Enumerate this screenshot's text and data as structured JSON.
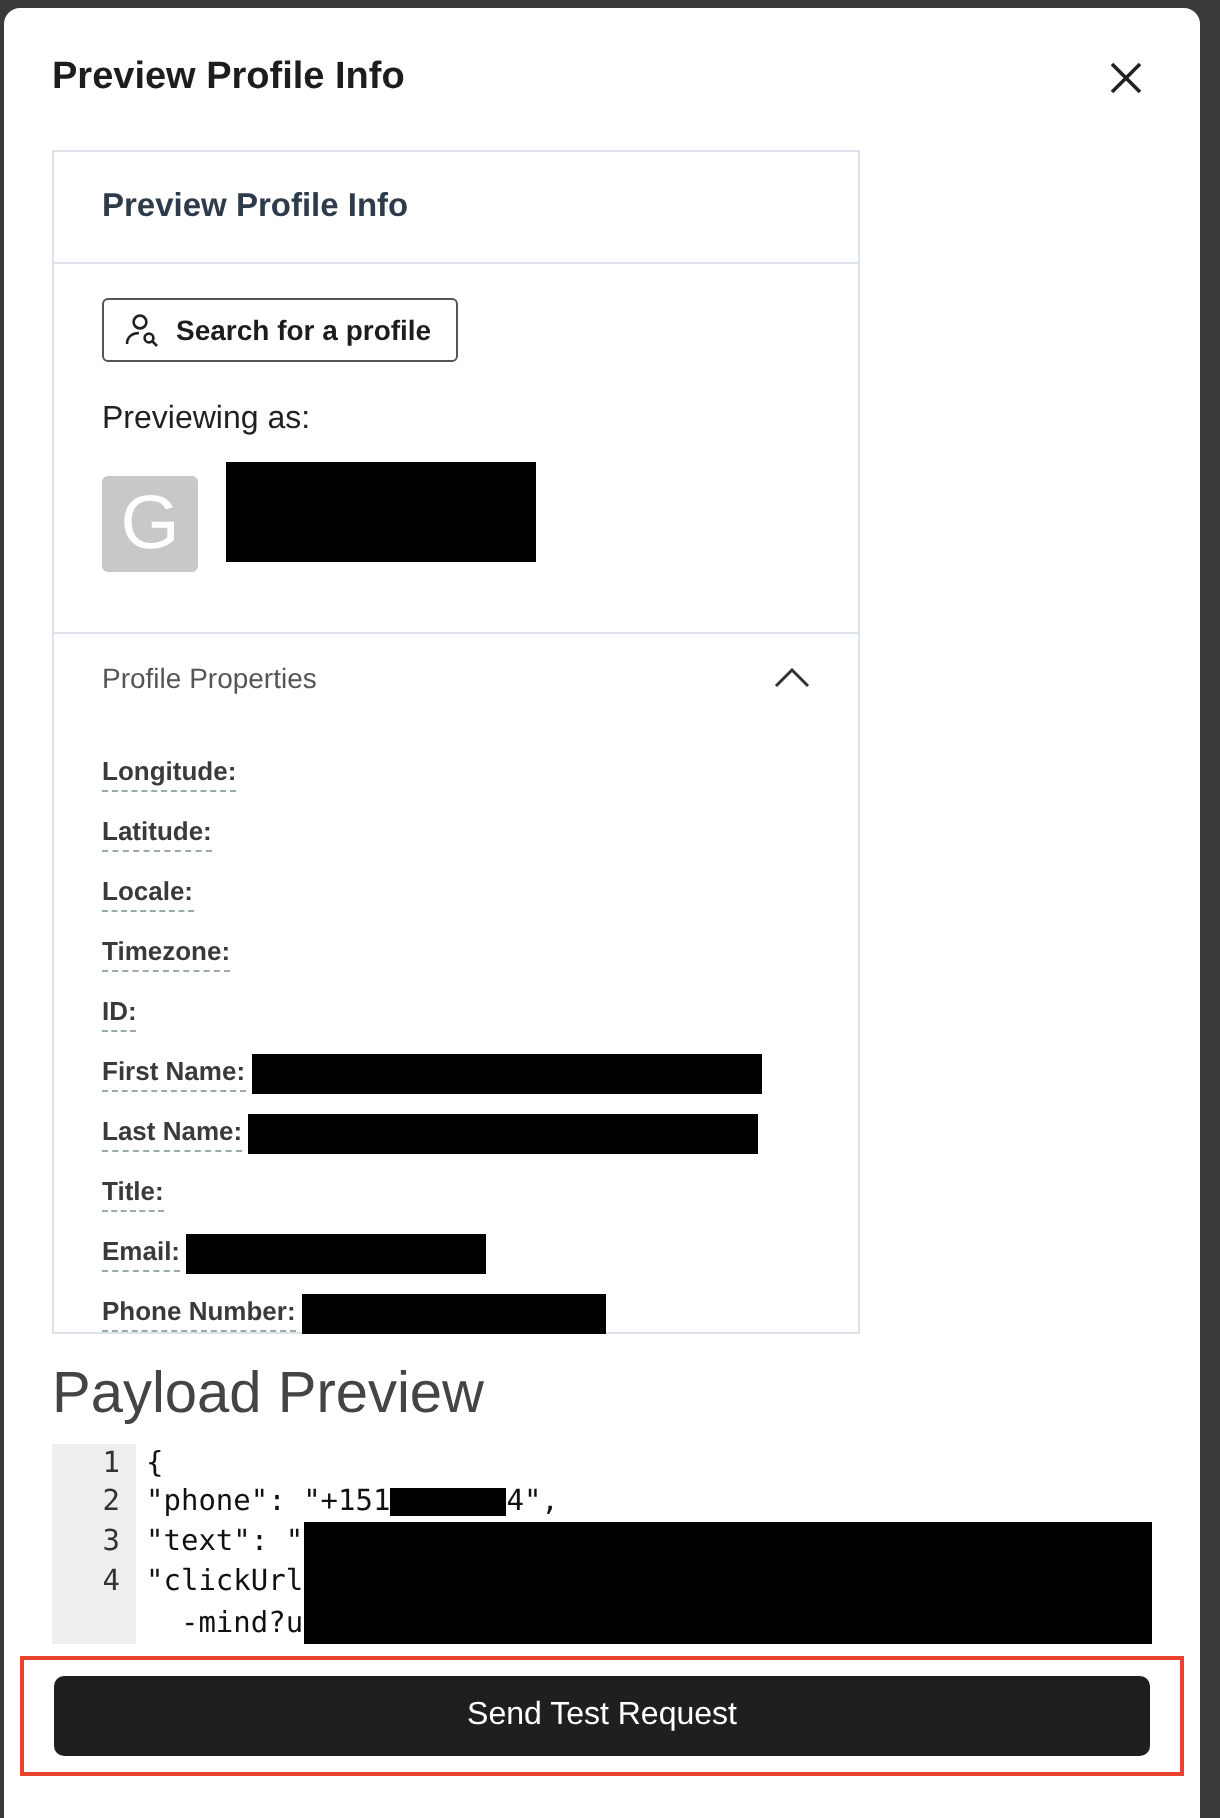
{
  "dialog": {
    "title": "Preview Profile Info"
  },
  "profile_card": {
    "title": "Preview Profile Info",
    "search_button": "Search for a profile",
    "previewing_label": "Previewing as:",
    "avatar_letter": "G",
    "name_redacted": true
  },
  "properties": {
    "title": "Profile Properties",
    "expanded": true,
    "items": [
      {
        "label": "Longitude:",
        "redacted": false
      },
      {
        "label": "Latitude:",
        "redacted": false
      },
      {
        "label": "Locale:",
        "redacted": false
      },
      {
        "label": "Timezone:",
        "redacted": false
      },
      {
        "label": "ID:",
        "redacted": false
      },
      {
        "label": "First Name:",
        "redacted": true
      },
      {
        "label": "Last Name:",
        "redacted": true
      },
      {
        "label": "Title:",
        "redacted": false
      },
      {
        "label": "Email:",
        "redacted": true
      },
      {
        "label": "Phone Number:",
        "redacted": true
      }
    ]
  },
  "payload": {
    "title": "Payload Preview",
    "lines": [
      {
        "number": "1",
        "text": "{"
      },
      {
        "number": "2",
        "text": "\"phone\": \"+151",
        "redacted_middle": true,
        "after": "4\","
      },
      {
        "number": "3",
        "text": "\"text\": \"",
        "redacted_rest": true
      },
      {
        "number": "4",
        "text": "\"clickUrl",
        "redacted_rest": true
      },
      {
        "text": "  -mind?u",
        "redacted_rest": true
      }
    ]
  },
  "send_button": {
    "label": "Send Test Request",
    "highlighted": true
  }
}
